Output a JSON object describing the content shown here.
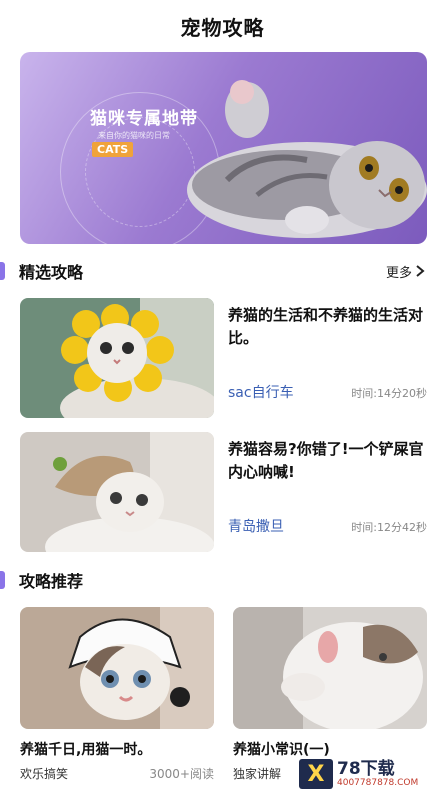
{
  "header": {
    "title": "宠物攻略"
  },
  "banner": {
    "title": "猫咪专属地带",
    "subtitle": "来自你的猫咪的日常",
    "badge": "CATS"
  },
  "featured": {
    "section_title": "精选攻略",
    "more_label": "更多",
    "items": [
      {
        "title": "养猫的生活和不养猫的生活对比。",
        "author": "sac自行车",
        "time": "时间:14分20秒"
      },
      {
        "title": "养猫容易?你错了!一个铲屎官内心呐喊!",
        "author": "青岛撒旦",
        "time": "时间:12分42秒"
      }
    ]
  },
  "recommend": {
    "section_title": "攻略推荐",
    "items": [
      {
        "title": "养猫千日,用猫一时。",
        "tag": "欢乐搞笑",
        "reads": "3000+阅读"
      },
      {
        "title": "养猫小常识(一)",
        "tag": "独家讲解",
        "reads": ""
      }
    ]
  },
  "watermark": {
    "logo": "X",
    "brand": "78下载",
    "url": "4007787878.COM"
  },
  "colors": {
    "accent": "#8a74e8",
    "author": "#3a5fb3",
    "banner": "#9b7ad1"
  }
}
